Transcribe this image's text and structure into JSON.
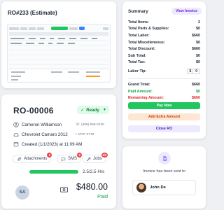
{
  "estimate": {
    "title": "RO#233 (Estimate)"
  },
  "summary": {
    "heading": "Summary",
    "view_invoice": "View Invoice",
    "rows": [
      {
        "label": "Total Items:",
        "value": "2"
      },
      {
        "label": "Total Parts & Supplies:",
        "value": "$0"
      },
      {
        "label": "Total Labor:",
        "value": "$660"
      },
      {
        "label": "Total Miscelleneous:",
        "value": "$0"
      },
      {
        "label": "Total Discount:",
        "value": "$660"
      },
      {
        "label": "Sub Total:",
        "value": "$0"
      },
      {
        "label": "Total Tax:",
        "value": "$0"
      }
    ],
    "labor_tip": {
      "label": "Labor Tip:",
      "currency": "$",
      "amount": "0"
    },
    "grand_total": {
      "label": "Grand Total:",
      "value": "$660"
    },
    "paid_amount": {
      "label": "Paid Amount:",
      "value": "$0"
    },
    "remaining_amount": {
      "label": "Remaining Amount:",
      "value": "$660"
    },
    "pay_now": "Pay Now",
    "add_extra": "Add Extra Amount",
    "close_ro": "Close RO",
    "colors": {
      "green": "#22c55e",
      "purple": "#6d28d9",
      "red": "#dc2626",
      "orange": "#c2410c"
    }
  },
  "ro": {
    "number": "RO-00006",
    "status": "Ready",
    "customer": "Cameron Williamson",
    "phone": "(406) 555-0120",
    "vehicle": "Chevrolet Camaro 2012",
    "plate": "MYP-2776",
    "created": "Created (1/1/2023) at 11:09 AM",
    "chips": [
      {
        "label": "Attachments",
        "badge": "2",
        "icon": "paperclip-icon"
      },
      {
        "label": "SMS",
        "badge": "4",
        "icon": "chat-icon"
      },
      {
        "label": "Jobs",
        "badge": "1/3",
        "icon": "wrench-icon"
      }
    ],
    "hours": "2.5/2.5 Hrs",
    "hours_progress": 1.0,
    "avatar_initials": "SA",
    "price": "$480.00",
    "paid": "Paid"
  },
  "invoice": {
    "message": "Invoice has been sent to",
    "recipient": "John De"
  }
}
